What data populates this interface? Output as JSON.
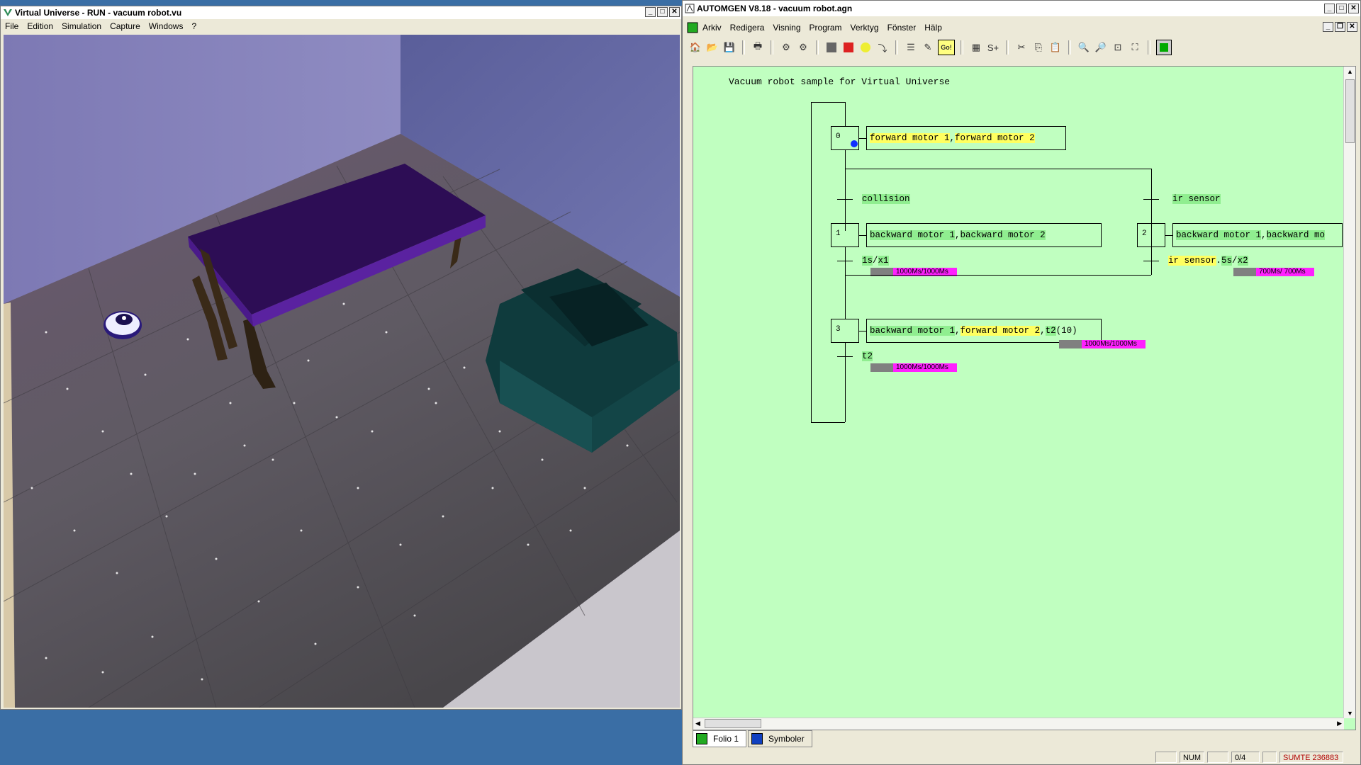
{
  "left_window": {
    "title": "Virtual Universe - RUN - vacuum robot.vu",
    "menu": [
      "File",
      "Edition",
      "Simulation",
      "Capture",
      "Windows",
      "?"
    ],
    "controls": {
      "minimize": "_",
      "maximize": "□",
      "close": "✕"
    }
  },
  "right_window": {
    "title": "AUTOMGEN V8.18 - vacuum robot.agn",
    "menu": [
      "Arkiv",
      "Redigera",
      "Visning",
      "Program",
      "Verktyg",
      "Fönster",
      "Hälp"
    ],
    "controls": {
      "minimize": "_",
      "maximize": "□",
      "close": "✕"
    },
    "toolbar_icons": [
      "new-icon",
      "open-icon",
      "save-icon",
      "print-icon",
      "compile-icon",
      "compile-all-icon",
      "stop-icon",
      "stop-red-icon",
      "run-icon",
      "step-icon",
      "align-icon",
      "edit-icon",
      "go-icon",
      "list-icon",
      "symbol-icon",
      "cut-icon",
      "copy-icon",
      "paste-icon",
      "zoom-in-icon",
      "zoom-out-icon",
      "zoom-fit-icon",
      "zoom-page-icon",
      "green-run-icon"
    ],
    "go_label": "Go!",
    "sheet": {
      "title": "Vacuum robot sample for Virtual Universe",
      "steps": [
        {
          "num": "0",
          "action": [
            {
              "text": "forward motor 1",
              "hl": "y"
            },
            {
              "text": ",",
              "hl": ""
            },
            {
              "text": "forward motor 2",
              "hl": "y"
            }
          ]
        },
        {
          "num": "1",
          "action": [
            {
              "text": "backward motor 1",
              "hl": "g"
            },
            {
              "text": ",",
              "hl": ""
            },
            {
              "text": "backward motor 2",
              "hl": "g"
            }
          ]
        },
        {
          "num": "2",
          "action": [
            {
              "text": "backward motor 1",
              "hl": "g"
            },
            {
              "text": ",",
              "hl": ""
            },
            {
              "text": "backward mo",
              "hl": "g"
            }
          ]
        },
        {
          "num": "3",
          "action": [
            {
              "text": "backward motor 1",
              "hl": "g"
            },
            {
              "text": ",",
              "hl": ""
            },
            {
              "text": "forward motor 2",
              "hl": "y"
            },
            {
              "text": ",",
              "hl": ""
            },
            {
              "text": "t2",
              "hl": "g"
            },
            {
              "text": "(10)",
              "hl": ""
            }
          ]
        }
      ],
      "transitions": {
        "collision": "collision",
        "ir_sensor": "ir sensor",
        "t1": {
          "a": "1s",
          "b": "/",
          "c": "x1"
        },
        "t2": {
          "a": "ir sensor",
          "b": ".",
          "c": "5s",
          "d": "/",
          "e": "x2"
        },
        "t3": "t2"
      },
      "timers": {
        "t1": "1000Ms/1000Ms",
        "t2": "700Ms/ 700Ms",
        "t3": "1000Ms/1000Ms",
        "t4": "1000Ms/1000Ms"
      }
    },
    "tabs": [
      "Folio 1",
      "Symboler"
    ],
    "status": {
      "num": "NUM",
      "page": "0/4",
      "user": "SUMTE 236883"
    }
  }
}
